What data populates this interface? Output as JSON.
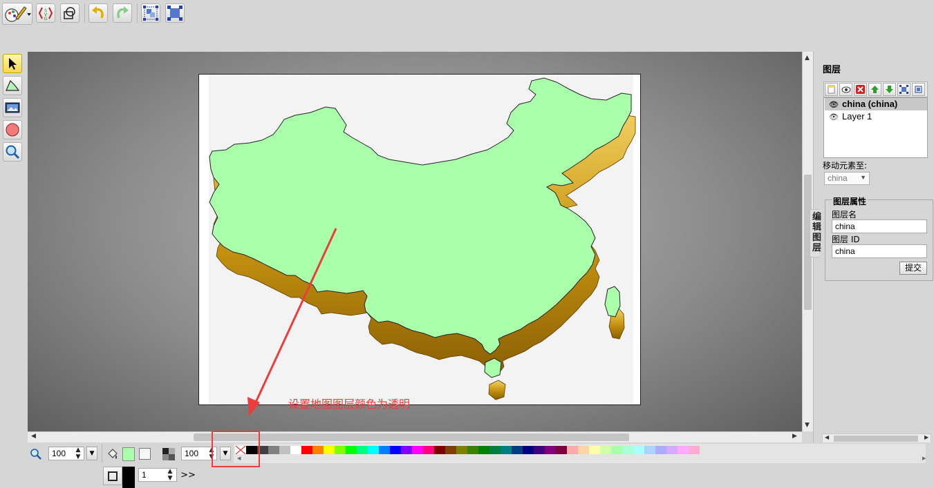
{
  "toolbar": {
    "main_menu_icon": "paint-brush-logo-icon",
    "items": [
      "svg-source-icon",
      "wireframe-icon",
      "undo-icon",
      "redo-icon",
      "group-icon",
      "ungroup-icon"
    ]
  },
  "tools": [
    "select-tool-icon",
    "path-tool-icon",
    "image-tool-icon",
    "ellipse-tool-icon",
    "zoom-tool-icon"
  ],
  "canvas": {
    "map_fill": "#aaffaa",
    "extrusion_color": "#d4a512",
    "annotation_text": "设置地图图层颜色为透明",
    "annotation_color": "#ee3b3b"
  },
  "layers_panel": {
    "title": "图层",
    "tab_label": "编辑图层",
    "layers": [
      {
        "name": "china (china)",
        "selected": true
      },
      {
        "name": "Layer 1",
        "selected": false
      }
    ],
    "move_to_label": "移动元素至:",
    "move_to_value": "china",
    "props_legend": "图层属性",
    "layer_name_label": "图层名",
    "layer_name_value": "china",
    "layer_id_label": "图层 ID",
    "layer_id_value": "china",
    "submit_label": "提交"
  },
  "bottom": {
    "zoom_value": "100",
    "fill_color": "#aaffaa",
    "stroke_color": "#000000",
    "opacity_value": "100",
    "stroke_width_value": "1",
    "more_label": ">>",
    "palette": [
      "#000000",
      "#404040",
      "#808080",
      "#c0c0c0",
      "#ffffff",
      "#ff0000",
      "#ff7f00",
      "#ffff00",
      "#7fff00",
      "#00ff00",
      "#00ff7f",
      "#00ffff",
      "#007fff",
      "#0000ff",
      "#7f00ff",
      "#ff00ff",
      "#ff007f",
      "#7f0000",
      "#7f3f00",
      "#7f7f00",
      "#3f7f00",
      "#007f00",
      "#007f3f",
      "#007f7f",
      "#003f7f",
      "#00007f",
      "#3f007f",
      "#7f007f",
      "#7f003f",
      "#ffaaaa",
      "#ffd4aa",
      "#ffffaa",
      "#d4ffaa",
      "#aaffaa",
      "#aaffd4",
      "#aaffff",
      "#aad4ff",
      "#aaaaff",
      "#d4aaff",
      "#ffaaff",
      "#ffaad4"
    ]
  }
}
